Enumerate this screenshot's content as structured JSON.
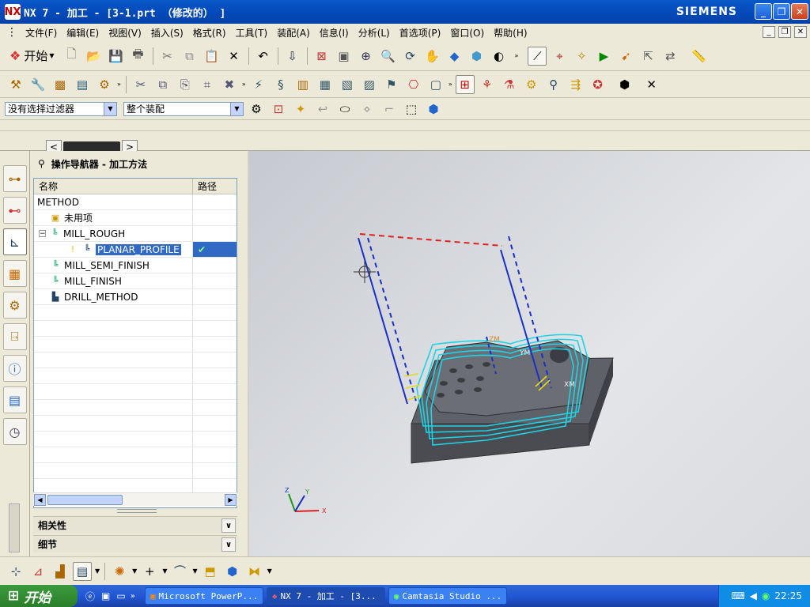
{
  "window": {
    "title": "NX 7 - 加工 - [3-1.prt （修改的） ]",
    "brand": "SIEMENS",
    "logo": "NX"
  },
  "menu": [
    "文件(F)",
    "编辑(E)",
    "视图(V)",
    "插入(S)",
    "格式(R)",
    "工具(T)",
    "装配(A)",
    "信息(I)",
    "分析(L)",
    "首选项(P)",
    "窗口(O)",
    "帮助(H)"
  ],
  "toolbar1": {
    "start_label": "开始",
    "icons": [
      "new-icon",
      "open-icon",
      "save-icon",
      "print-icon",
      "cut-icon",
      "copy-icon",
      "paste-icon",
      "delete-icon",
      "undo-icon",
      "command-finder-icon",
      "fit-icon",
      "zoom-window-icon",
      "zoom-icon",
      "rotate-icon",
      "pan-icon",
      "perspective-icon",
      "render-style-icon",
      "shade-icon",
      "wcs-icon",
      "csys-icon",
      "geometry-icon",
      "operation-icon",
      "move-icon",
      "select-icon",
      "measure-icon"
    ]
  },
  "filter_bar": {
    "selection_filter": "没有选择过滤器",
    "scope": "整个装配"
  },
  "navigator": {
    "title": "操作导航器 - 加工方法",
    "col_name": "名称",
    "col_path": "路径",
    "rows": [
      {
        "name": "METHOD",
        "path": ""
      },
      {
        "name": "未用项",
        "path": ""
      },
      {
        "name": "MILL_ROUGH",
        "path": ""
      },
      {
        "name": "PLANAR_PROFILE",
        "path": "✔"
      },
      {
        "name": "MILL_SEMI_FINISH",
        "path": ""
      },
      {
        "name": "MILL_FINISH",
        "path": ""
      },
      {
        "name": "DRILL_METHOD",
        "path": ""
      }
    ],
    "section_dependencies": "相关性",
    "section_details": "细节"
  },
  "viewport": {
    "axis_x": "X",
    "axis_y": "Y",
    "axis_z": "Z",
    "label_zm": "ZM",
    "label_ym": "YM",
    "label_xm": "XM"
  },
  "taskbar": {
    "start": "开始",
    "tasks": [
      "Microsoft PowerP...",
      "NX 7 - 加工 - [3...",
      "Camtasia Studio ..."
    ],
    "clock": "22:25"
  },
  "colors": {
    "titlebar": "#0a58c8",
    "selection": "#316ac5",
    "toolpath": "#1dd3e6",
    "tool_axis": "#1a2fc8",
    "clearance": "#e02020"
  }
}
